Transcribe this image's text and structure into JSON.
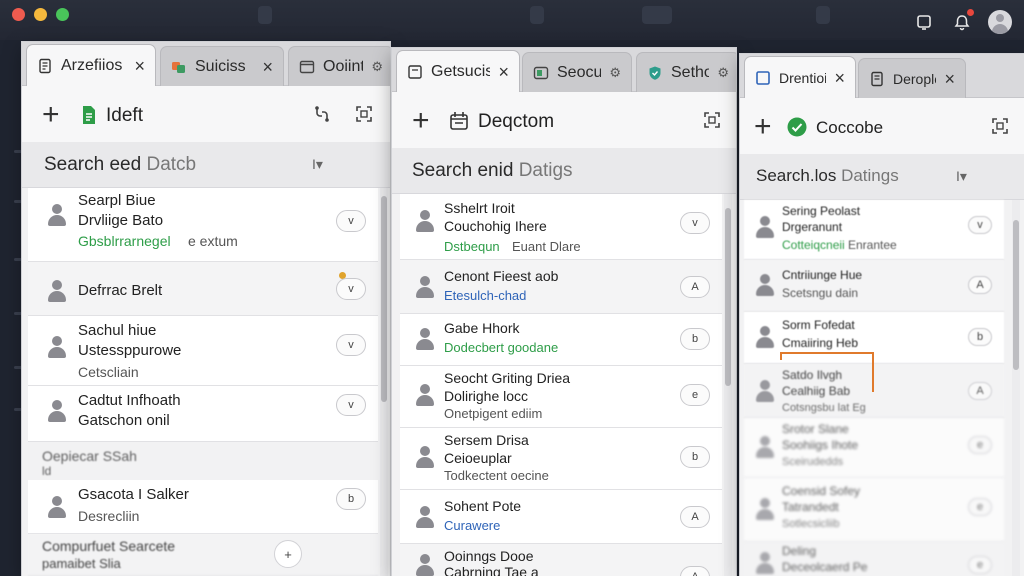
{
  "panels": [
    {
      "tabs": [
        {
          "label": "Arzefiios",
          "active": true
        },
        {
          "label": "Suiciss",
          "active": false
        },
        {
          "label": "Ooiint",
          "active": false
        }
      ],
      "toolbar": {
        "label": "Ideft"
      },
      "search": {
        "label": "Search eed",
        "hint": "Datcb"
      },
      "rows": [
        {
          "line1": "Searpl Biue",
          "line2": "Drvliige Bato",
          "sub": "Gbsblrrarnegel",
          "sub2": "e extum",
          "color": "green",
          "btn": "v"
        },
        {
          "line1": "Defrrac Brelt",
          "btn": "v"
        },
        {
          "line1": "Sachul hiue",
          "line2": "Ustessppurowe",
          "sub": "Cetscliain",
          "color": "grey",
          "btn": "v"
        },
        {
          "line1": "Cadtut Infhoath",
          "line2": "Gatschon onil",
          "btn": "v"
        },
        {
          "line1": "Gsacota I Salker",
          "sub": "Desrecliin",
          "color": "grey",
          "btn": "b"
        }
      ],
      "section_label": "Oepiecar SSah",
      "section_sub": "ld",
      "footer": {
        "line1": "Compurfuet Searcete",
        "line2": "pamaibet Slia"
      },
      "fab": "+"
    },
    {
      "tabs": [
        {
          "label": "Getsucis",
          "active": true
        },
        {
          "label": "Seocuts",
          "active": false
        },
        {
          "label": "Sethont",
          "active": false
        }
      ],
      "toolbar": {
        "label": "Deqctom"
      },
      "search": {
        "label": "Search enid",
        "hint": "Datigs"
      },
      "rows": [
        {
          "line1": "Sshelrt Iroit",
          "line2": "Couchohig Ihere",
          "sub": "Dstbequn",
          "sub2": "Euant Dlare",
          "color": "green",
          "btn": "v"
        },
        {
          "line1": "Cenont Fieest aob",
          "sub": "Etesulch-chad",
          "color": "blue",
          "btn": "A"
        },
        {
          "line1": "Gabe Hhork",
          "sub": "Dodecbert goodane",
          "color": "green",
          "btn": "b"
        },
        {
          "line1": "Seocht Griting Driea",
          "line2": "Dolirighe locc",
          "sub": "Onetpigent ediim",
          "color": "grey",
          "btn": "e"
        },
        {
          "line1": "Sersem Drisa",
          "line2": "Ceioeuplar",
          "sub": "Todkectent oecine",
          "color": "grey",
          "btn": "b"
        },
        {
          "line1": "Sohent Pote",
          "sub": "Curawere",
          "color": "blue",
          "btn": "A"
        },
        {
          "line1": "Ooinngs Dooe",
          "line2": "Cabrning Tae a",
          "btn": "A"
        }
      ]
    },
    {
      "tabs": [
        {
          "label": "Drentiois",
          "active": true
        },
        {
          "label": "Deroplosec",
          "active": false
        }
      ],
      "toolbar": {
        "label": "Coccobe"
      },
      "search": {
        "label": "Search.los",
        "hint": "Datings"
      },
      "rows": [
        {
          "line1": "Sering Peolast",
          "line2": "Drgeranunt",
          "sub": "Cotteiqcneii",
          "sub2": "Enrantee",
          "color": "green",
          "btn": "v"
        },
        {
          "line1": "Cntriiunge Hue",
          "sub": "Scetsngu dain",
          "color": "grey",
          "btn": "A"
        },
        {
          "line1": "Sorm Fofedat",
          "line2": "Cmaiiring Heb",
          "btn": "b"
        },
        {
          "line1": "Satdo Ilvgh",
          "line2": "Cealhiig Bab",
          "sub": "Cotsngsbu lat Eg",
          "color": "grey",
          "btn": "A"
        },
        {
          "line1": "Srotor Slane",
          "line2": "Soohiigs Ihote",
          "sub": "Sceirudedds",
          "color": "grey",
          "btn": "e"
        },
        {
          "line1": "Coensid Sofey",
          "line2": "Tatrandedt",
          "sub": "Sotlecsicliib",
          "color": "grey",
          "btn": "e"
        },
        {
          "line1": "Deling",
          "line2": "Deceolcaerd Pe",
          "btn": "e"
        }
      ]
    }
  ],
  "colors": {
    "accent_green": "#2e9d48",
    "accent_blue": "#2f64b8",
    "highlight": "#e07a2c"
  }
}
